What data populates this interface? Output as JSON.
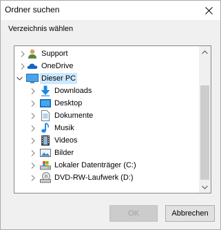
{
  "window": {
    "title": "Ordner suchen"
  },
  "prompt": "Verzeichnis wählen",
  "tree": {
    "items": [
      {
        "label": "Support",
        "icon": "user-folder-icon",
        "expander": "chevron-right-icon",
        "level": 1
      },
      {
        "label": "OneDrive",
        "icon": "onedrive-cloud-icon",
        "expander": "chevron-right-icon",
        "level": 1
      },
      {
        "label": "Dieser PC",
        "icon": "this-pc-monitor-icon",
        "expander": "chevron-down-icon",
        "level": 1,
        "selected": true
      },
      {
        "label": "Downloads",
        "icon": "downloads-arrow-icon",
        "expander": "chevron-right-icon",
        "level": 2
      },
      {
        "label": "Desktop",
        "icon": "desktop-icon",
        "expander": "chevron-right-icon",
        "level": 2
      },
      {
        "label": "Dokumente",
        "icon": "documents-icon",
        "expander": "chevron-right-icon",
        "level": 2
      },
      {
        "label": "Musik",
        "icon": "music-note-icon",
        "expander": "chevron-right-icon",
        "level": 2
      },
      {
        "label": "Videos",
        "icon": "video-film-icon",
        "expander": "chevron-right-icon",
        "level": 2
      },
      {
        "label": "Bilder",
        "icon": "pictures-icon",
        "expander": "chevron-right-icon",
        "level": 2
      },
      {
        "label": "Lokaler Datenträger (C:)",
        "icon": "local-disk-icon",
        "expander": "chevron-right-icon",
        "level": 2
      },
      {
        "label": "DVD-RW-Laufwerk (D:)",
        "icon": "dvd-drive-icon",
        "expander": "chevron-right-icon",
        "level": 2
      }
    ]
  },
  "buttons": {
    "ok": "OK",
    "cancel": "Abbrechen"
  },
  "colors": {
    "selection": "#cce8ff",
    "dialog_bg": "#f0f0f0",
    "accent_blue": "#1e88e5"
  }
}
